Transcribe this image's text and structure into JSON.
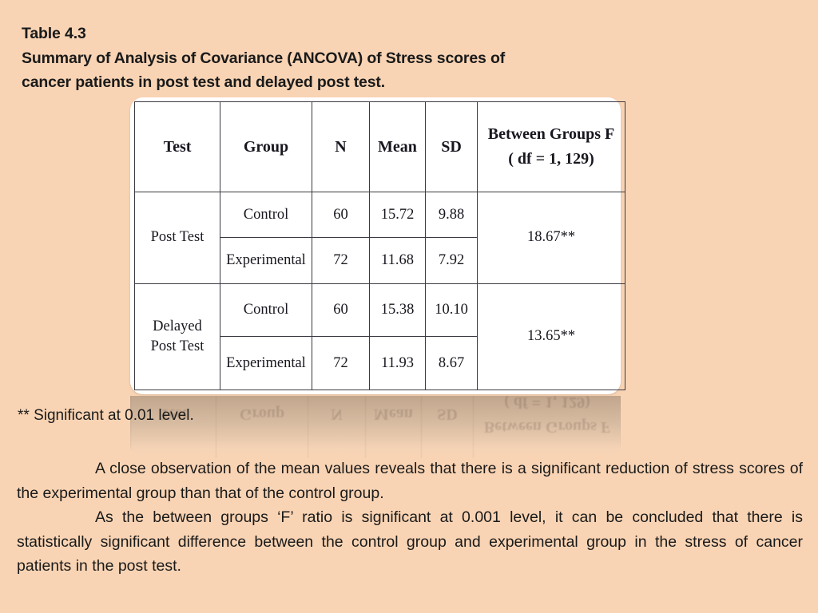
{
  "slide": {
    "background_color": "#F9D4B4",
    "text_color": "#1A1A1A"
  },
  "title": {
    "line1": "Table 4.3",
    "line2": "Summary of Analysis of Covariance (ANCOVA) of Stress scores of",
    "line3": "cancer patients in post test and delayed post test."
  },
  "table": {
    "headers": {
      "test": "Test",
      "group": "Group",
      "n": "N",
      "mean": "Mean",
      "sd": "SD",
      "f_line1": "Between Groups F",
      "f_line2": "( df = 1, 129)"
    },
    "rows": [
      {
        "test": "Post Test",
        "test_line1": "Post Test",
        "test_line2": "",
        "f": "18.67**",
        "subrows": [
          {
            "group": "Control",
            "n": "60",
            "mean": "15.72",
            "sd": "9.88"
          },
          {
            "group": "Experimental",
            "n": "72",
            "mean": "11.68",
            "sd": "7.92"
          }
        ]
      },
      {
        "test": "Delayed Post Test",
        "test_line1": "Delayed",
        "test_line2": "Post Test",
        "f": "13.65**",
        "subrows": [
          {
            "group": "Control",
            "n": "60",
            "mean": "15.38",
            "sd": "10.10"
          },
          {
            "group": "Experimental",
            "n": "72",
            "mean": "11.93",
            "sd": "8.67"
          }
        ]
      }
    ]
  },
  "footnote": "** Significant at 0.01 level.",
  "body": {
    "paragraph1": "A close observation of the mean values reveals that there is a significant reduction of stress scores of the experimental group than that of the control group.",
    "paragraph2": "As the between groups ‘F’ ratio is significant at 0.001 level, it can be concluded that there is statistically significant difference between the control group and experimental group in the stress of cancer patients in the post test."
  }
}
